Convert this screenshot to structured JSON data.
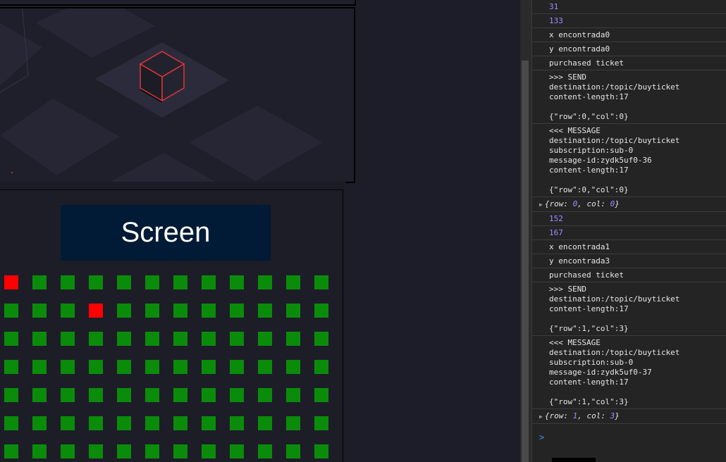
{
  "screen_label": "Screen",
  "seats": {
    "rows": 7,
    "cols": 12,
    "purchased": [
      [
        0,
        0
      ],
      [
        1,
        3
      ]
    ],
    "colors": {
      "available": "#0a8c0a",
      "purchased": "#ff0000"
    }
  },
  "console": {
    "prompt": ">",
    "entries": [
      {
        "type": "num",
        "text": "31"
      },
      {
        "type": "num",
        "text": "133"
      },
      {
        "type": "log",
        "text": "x encontrada0"
      },
      {
        "type": "log",
        "text": "y encontrada0"
      },
      {
        "type": "log",
        "text": "purchased ticket"
      },
      {
        "type": "log",
        "text": ">>> SEND\ndestination:/topic/buyticket\ncontent-length:17\n\n{\"row\":0,\"col\":0}"
      },
      {
        "type": "log",
        "text": "<<< MESSAGE\ndestination:/topic/buyticket\nsubscription:sub-0\nmessage-id:zydk5uf0-36\ncontent-length:17\n\n{\"row\":0,\"col\":0}"
      },
      {
        "type": "obj",
        "text": "{row: 0, col: 0}"
      },
      {
        "type": "num",
        "text": "152"
      },
      {
        "type": "num",
        "text": "167"
      },
      {
        "type": "log",
        "text": "x encontrada1"
      },
      {
        "type": "log",
        "text": "y encontrada3"
      },
      {
        "type": "log",
        "text": "purchased ticket"
      },
      {
        "type": "log",
        "text": ">>> SEND\ndestination:/topic/buyticket\ncontent-length:17\n\n{\"row\":1,\"col\":3}"
      },
      {
        "type": "log",
        "text": "<<< MESSAGE\ndestination:/topic/buyticket\nsubscription:sub-0\nmessage-id:zydk5uf0-37\ncontent-length:17\n\n{\"row\":1,\"col\":3}"
      },
      {
        "type": "obj",
        "text": "{row: 1, col: 3}"
      }
    ]
  }
}
